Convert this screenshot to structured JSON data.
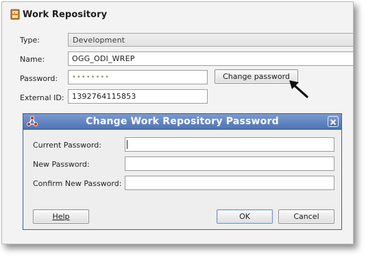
{
  "window": {
    "title": "Work Repository"
  },
  "form": {
    "type_label": "Type:",
    "type_value": "Development",
    "name_label": "Name:",
    "name_value": "OGG_ODI_WREP",
    "password_label": "Password:",
    "password_value": "••••••••",
    "change_password_button": "Change password",
    "external_id_label": "External ID:",
    "external_id_value": "1392764115853"
  },
  "dialog": {
    "title": "Change Work Repository Password",
    "current_password_label": "Current Password:",
    "current_password_value": "",
    "new_password_label": "New Password:",
    "new_password_value": "",
    "confirm_password_label": "Confirm New Password:",
    "confirm_password_value": "",
    "help_button": "Help",
    "ok_button": "OK",
    "cancel_button": "Cancel"
  },
  "colors": {
    "dialog_titlebar": "#5a7cbf",
    "frame_background": "#f3f3f3"
  },
  "icons": {
    "window": "repository-icon",
    "dialog": "odi-connection-icon",
    "close": "close-icon",
    "pointer": "pointer-arrow-icon"
  }
}
